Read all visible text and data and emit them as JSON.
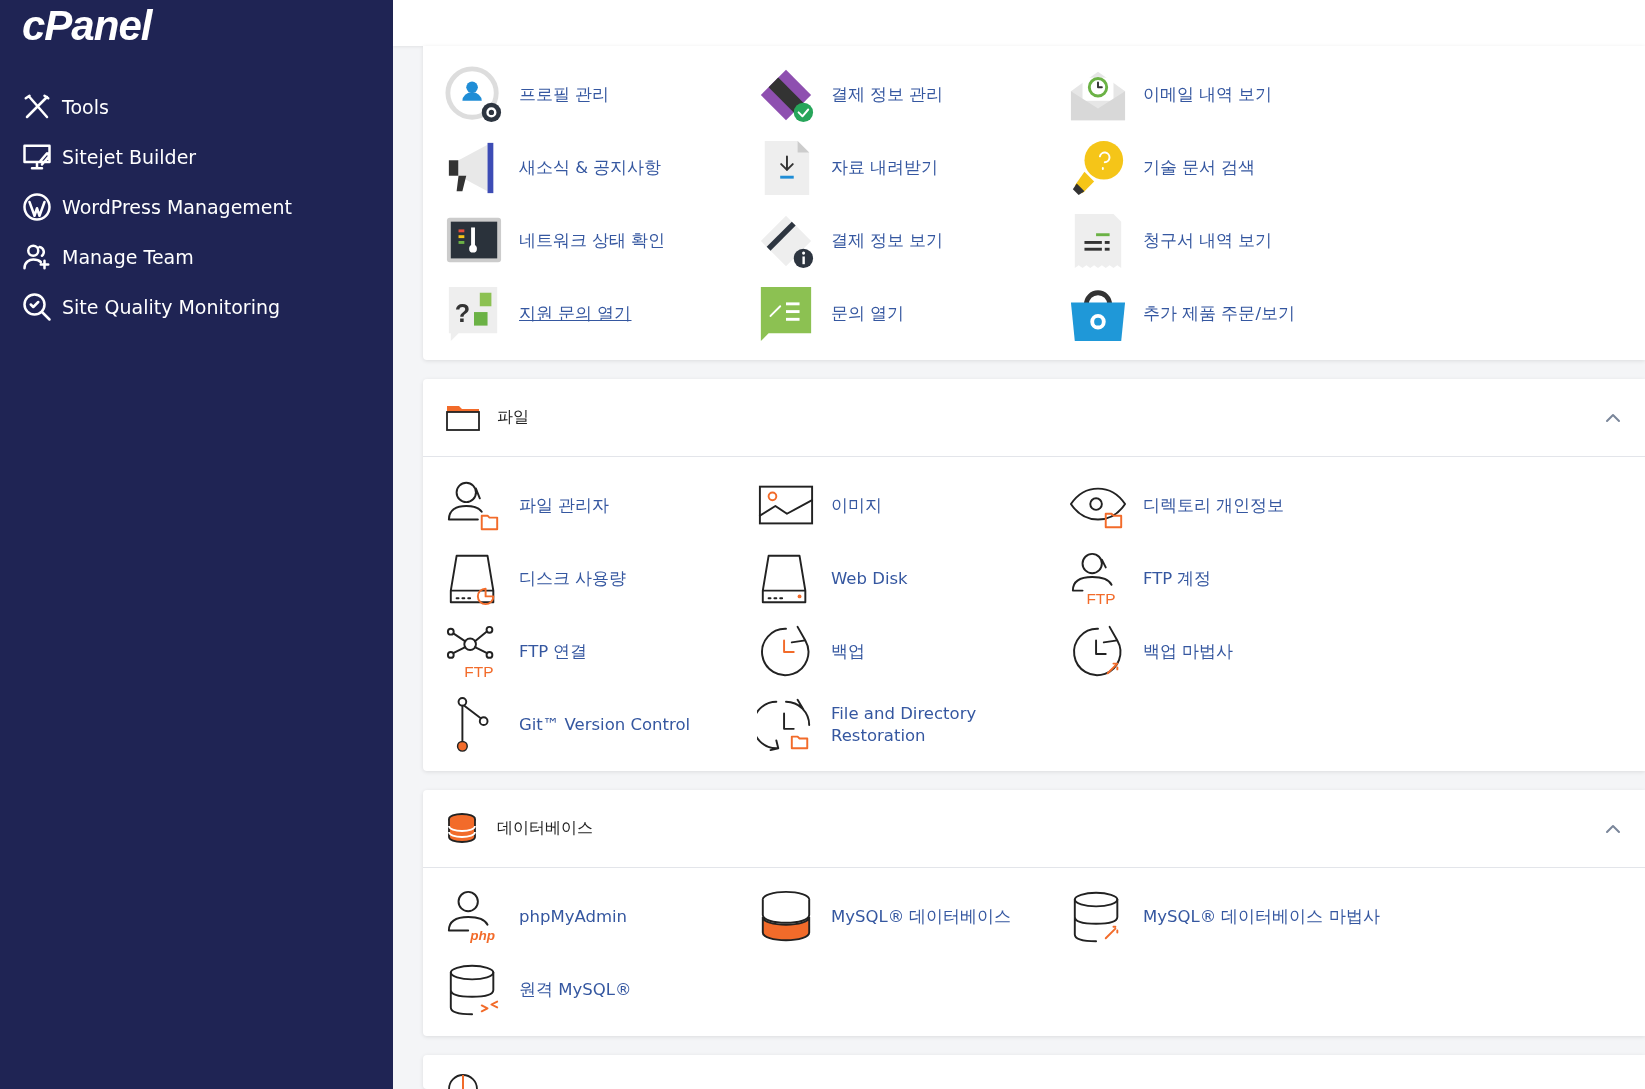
{
  "sidebar": {
    "logo": "cPanel",
    "items": [
      {
        "label": "Tools"
      },
      {
        "label": "Sitejet Builder"
      },
      {
        "label": "WordPress Management"
      },
      {
        "label": "Manage Team"
      },
      {
        "label": "Site Quality Monitoring"
      }
    ]
  },
  "sections": [
    {
      "items": [
        {
          "label": "프로필 관리",
          "hovered": false
        },
        {
          "label": "결제 정보 관리",
          "hovered": false
        },
        {
          "label": "이메일 내역 보기",
          "hovered": false
        },
        {
          "label": "새소식 & 공지사항",
          "hovered": false
        },
        {
          "label": "자료 내려받기",
          "hovered": false
        },
        {
          "label": "기술 문서 검색",
          "hovered": false
        },
        {
          "label": "네트워크 상태 확인",
          "hovered": false
        },
        {
          "label": "결제 정보 보기",
          "hovered": false
        },
        {
          "label": "청구서 내역 보기",
          "hovered": false
        },
        {
          "label": "지원 문의 열기",
          "hovered": true,
          "icon_text": "?"
        },
        {
          "label": "문의 열기",
          "hovered": false
        },
        {
          "label": "추가 제품 주문/보기",
          "hovered": false
        }
      ]
    },
    {
      "title": "파일",
      "expanded": true,
      "items": [
        {
          "label": "파일 관리자",
          "hovered": false
        },
        {
          "label": "이미지",
          "hovered": false
        },
        {
          "label": "디렉토리 개인정보",
          "hovered": false
        },
        {
          "label": "디스크 사용량",
          "hovered": false
        },
        {
          "label": "Web Disk",
          "hovered": false
        },
        {
          "label": "FTP 계정",
          "hovered": false,
          "icon_text": "FTP"
        },
        {
          "label": "FTP 연결",
          "hovered": false,
          "icon_text": "FTP"
        },
        {
          "label": "백업",
          "hovered": false
        },
        {
          "label": "백업 마법사",
          "hovered": false
        },
        {
          "label": "Git™ Version Control",
          "hovered": false
        },
        {
          "label": "File and Directory Restoration",
          "hovered": false
        }
      ]
    },
    {
      "title": "데이터베이스",
      "expanded": true,
      "items": [
        {
          "label": "phpMyAdmin",
          "hovered": false,
          "icon_text": "php"
        },
        {
          "label": "MySQL® 데이터베이스",
          "hovered": false
        },
        {
          "label": "MySQL® 데이터베이스 마법사",
          "hovered": false
        },
        {
          "label": "원격 MySQL®",
          "hovered": false
        }
      ]
    }
  ]
}
